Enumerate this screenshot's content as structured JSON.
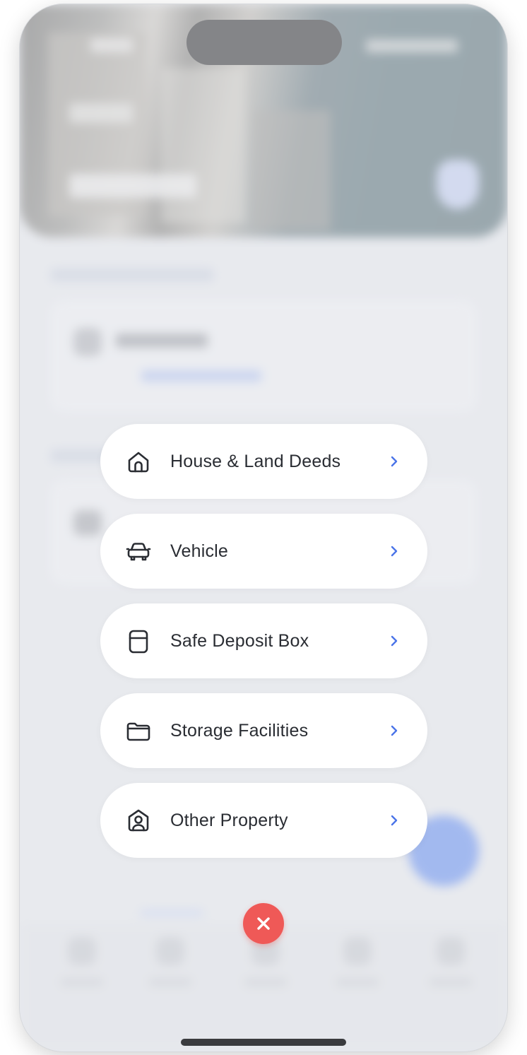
{
  "menu": {
    "items": [
      {
        "label": "House & Land Deeds",
        "icon": "house-icon"
      },
      {
        "label": "Vehicle",
        "icon": "car-icon"
      },
      {
        "label": "Safe Deposit Box",
        "icon": "box-icon"
      },
      {
        "label": "Storage Facilities",
        "icon": "folder-icon"
      },
      {
        "label": "Other Property",
        "icon": "user-badge-icon"
      }
    ],
    "chevron_icon": "chevron-right-icon"
  },
  "close_button": {
    "icon": "close-icon",
    "color": "#ef5957"
  },
  "colors": {
    "accent": "#4f7ff0",
    "chevron": "#4a74e8",
    "text": "#2a2d33",
    "close": "#ef5957"
  }
}
